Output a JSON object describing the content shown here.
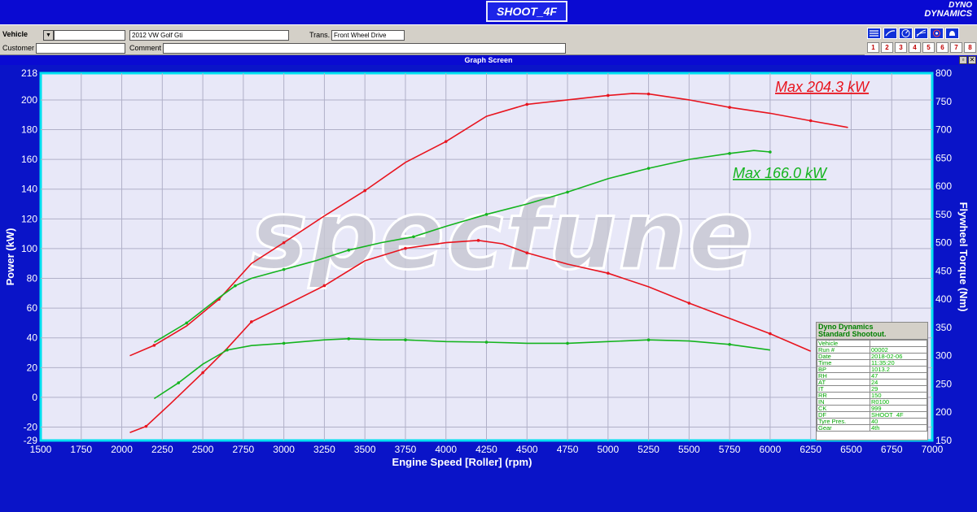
{
  "header": {
    "run_title": "SHOOT_4F",
    "brand_top": "DYNO",
    "brand_bottom": "DYNAMICS"
  },
  "form": {
    "vehicle_label": "Vehicle",
    "vehicle_value": "2012 VW Golf Gti",
    "trans_label": "Trans.",
    "trans_value": "Front Wheel Drive",
    "customer_label": "Customer",
    "customer_value": "",
    "comment_label": "Comment",
    "comment_value": ""
  },
  "toolbar": {
    "buttons": [
      "1",
      "2",
      "3",
      "4",
      "5",
      "6",
      "7",
      "8"
    ]
  },
  "graph_screen_title": "Graph Screen",
  "watermark": "specfune",
  "annotations": {
    "max_red": "Max 204.3 kW",
    "max_green": "Max 166.0 kW"
  },
  "legend": {
    "title_line1": "Dyno Dynamics",
    "title_line2": "Standard Shootout.",
    "rows": [
      [
        "Vehicle",
        ""
      ],
      [
        "Run #",
        "00002"
      ],
      [
        "Date",
        "2018-02-06"
      ],
      [
        "Time",
        "11:35:20"
      ],
      [
        "BP",
        "1013.2"
      ],
      [
        "RH",
        "47"
      ],
      [
        "AT",
        "24"
      ],
      [
        "IT",
        "29"
      ],
      [
        "RR",
        "150"
      ],
      [
        "IN",
        "R0100"
      ],
      [
        "CK",
        "999"
      ],
      [
        "DF",
        "SHOOT_4F"
      ],
      [
        "Tyre Pres.",
        "40"
      ],
      [
        "Gear",
        "4th"
      ]
    ]
  },
  "colors": {
    "red_series": "#e8141e",
    "green_series": "#14b41e",
    "plot_bg": "#e8e8f8",
    "plot_border": "#00e0f0"
  },
  "chart_data": {
    "type": "line",
    "xlabel": "Engine Speed [Roller] (rpm)",
    "ylabel": "Power (kW)",
    "y2label": "Flywheel Torque (Nm)",
    "xlim": [
      1500,
      7000
    ],
    "ylim": [
      -29,
      218
    ],
    "y2lim": [
      150,
      800
    ],
    "x_ticks": [
      1500,
      1750,
      2000,
      2250,
      2500,
      2750,
      3000,
      3250,
      3500,
      3750,
      4000,
      4250,
      4500,
      4750,
      5000,
      5250,
      5500,
      5750,
      6000,
      6250,
      6500,
      6750,
      7000
    ],
    "y_ticks": [
      -29,
      -20,
      0,
      20,
      40,
      60,
      80,
      100,
      120,
      140,
      160,
      180,
      200,
      218
    ],
    "y2_ticks": [
      150,
      200,
      250,
      300,
      350,
      400,
      450,
      500,
      550,
      600,
      650,
      700,
      750,
      800
    ],
    "grid": true,
    "series": [
      {
        "axis": "power",
        "color": "red",
        "x": [
          2050,
          2200,
          2400,
          2600,
          2800,
          3000,
          3250,
          3500,
          3750,
          4000,
          4250,
          4500,
          4750,
          5000,
          5150,
          5250,
          5500,
          5750,
          6000,
          6250,
          6480
        ],
        "y": [
          28,
          35,
          48,
          66,
          90,
          104,
          122,
          139,
          158,
          172,
          189,
          197,
          200,
          203,
          204.3,
          204,
          200,
          195,
          191,
          186,
          181.5
        ]
      },
      {
        "axis": "power",
        "color": "green",
        "x": [
          2200,
          2400,
          2600,
          2700,
          2800,
          3000,
          3200,
          3400,
          3600,
          3800,
          4000,
          4250,
          4500,
          4750,
          5000,
          5250,
          5500,
          5750,
          5900,
          6000
        ],
        "y": [
          37,
          50,
          67,
          75,
          80,
          86,
          92,
          99,
          104,
          108,
          115,
          123,
          130,
          138,
          147,
          154,
          160,
          164,
          166,
          165
        ]
      },
      {
        "axis": "torque",
        "color": "red",
        "x": [
          2050,
          2150,
          2300,
          2500,
          2650,
          2800,
          3000,
          3250,
          3500,
          3750,
          4000,
          4200,
          4350,
          4500,
          4750,
          5000,
          5250,
          5500,
          5750,
          6000,
          6250
        ],
        "y": [
          164,
          175,
          215,
          270,
          313,
          360,
          388,
          424,
          468,
          490,
          500,
          504,
          498,
          482,
          462,
          446,
          422,
          393,
          366,
          339,
          308
        ]
      },
      {
        "axis": "torque",
        "color": "green",
        "x": [
          2200,
          2350,
          2500,
          2650,
          2800,
          3000,
          3250,
          3400,
          3600,
          3750,
          4000,
          4250,
          4500,
          4750,
          5000,
          5250,
          5500,
          5750,
          6000
        ],
        "y": [
          224,
          252,
          285,
          310,
          318,
          322,
          328,
          330,
          328,
          328,
          325,
          324,
          322,
          322,
          325,
          328,
          326,
          320,
          310
        ]
      }
    ]
  }
}
